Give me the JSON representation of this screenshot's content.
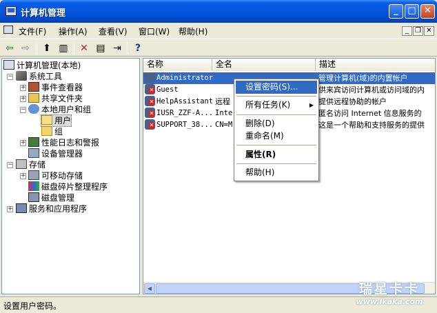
{
  "window": {
    "title": "计算机管理",
    "buttons": {
      "minimize": "_",
      "maximize": "□",
      "close": "✕"
    }
  },
  "menubar": {
    "items": [
      "文件(F)",
      "操作(A)",
      "查看(V)",
      "窗口(W)",
      "帮助(H)"
    ],
    "mdi": {
      "minimize": "_",
      "restore": "❐",
      "close": "✕"
    }
  },
  "toolbar": {
    "back": "⇦",
    "forward": "⇨",
    "up": "⬆",
    "tree_toggle": "▥",
    "delete": "✕",
    "properties": "▤",
    "export": "⇥",
    "help": "?"
  },
  "tree": {
    "root": "计算机管理(本地)",
    "nodes": [
      {
        "label": "系统工具",
        "icon": "tools-icon"
      },
      {
        "label": "事件查看器",
        "icon": "event-viewer-icon"
      },
      {
        "label": "共享文件夹",
        "icon": "shared-folder-icon"
      },
      {
        "label": "本地用户和组",
        "icon": "users-icon"
      },
      {
        "label": "用户",
        "icon": "folder-open-icon"
      },
      {
        "label": "组",
        "icon": "folder-icon"
      },
      {
        "label": "性能日志和警报",
        "icon": "performance-icon"
      },
      {
        "label": "设备管理器",
        "icon": "device-manager-icon"
      },
      {
        "label": "存储",
        "icon": "storage-icon"
      },
      {
        "label": "可移动存储",
        "icon": "removable-storage-icon"
      },
      {
        "label": "磁盘碎片整理程序",
        "icon": "defrag-icon"
      },
      {
        "label": "磁盘管理",
        "icon": "disk-management-icon"
      },
      {
        "label": "服务和应用程序",
        "icon": "services-icon"
      }
    ],
    "expanders": {
      "plus": "+",
      "minus": "−"
    }
  },
  "list": {
    "columns": [
      "名称",
      "全名",
      "描述"
    ],
    "rows": [
      {
        "name": "Administrator",
        "fullname": "",
        "desc": "管理计算机(域)的内置帐户",
        "disabled": false
      },
      {
        "name": "Guest",
        "fullname": "",
        "desc": "供来宾访问计算机或访问域的内",
        "disabled": true
      },
      {
        "name": "HelpAssistant",
        "fullname": "远程",
        "desc": "提供远程协助的帐户",
        "disabled": true
      },
      {
        "name": "IUSR_ZZF-A...",
        "fullname": "Inte",
        "desc": "匿名访问 Internet 信息服务的",
        "disabled": true
      },
      {
        "name": "SUPPORT_38...",
        "fullname": "CN=M",
        "desc": "这是一个帮助和支持服务的提供",
        "disabled": true
      }
    ],
    "scroll": {
      "left": "◀",
      "right": "▶"
    }
  },
  "context_menu": {
    "items": [
      "设置密码(S)...",
      "所有任务(K)",
      "删除(D)",
      "重命名(M)",
      "属性(R)",
      "帮助(H)"
    ],
    "submenu_arrow": "▶"
  },
  "statusbar": {
    "text": "设置用户密码。"
  },
  "watermark": {
    "brand": "瑞星卡卡",
    "url": "www.ikaka.com"
  }
}
